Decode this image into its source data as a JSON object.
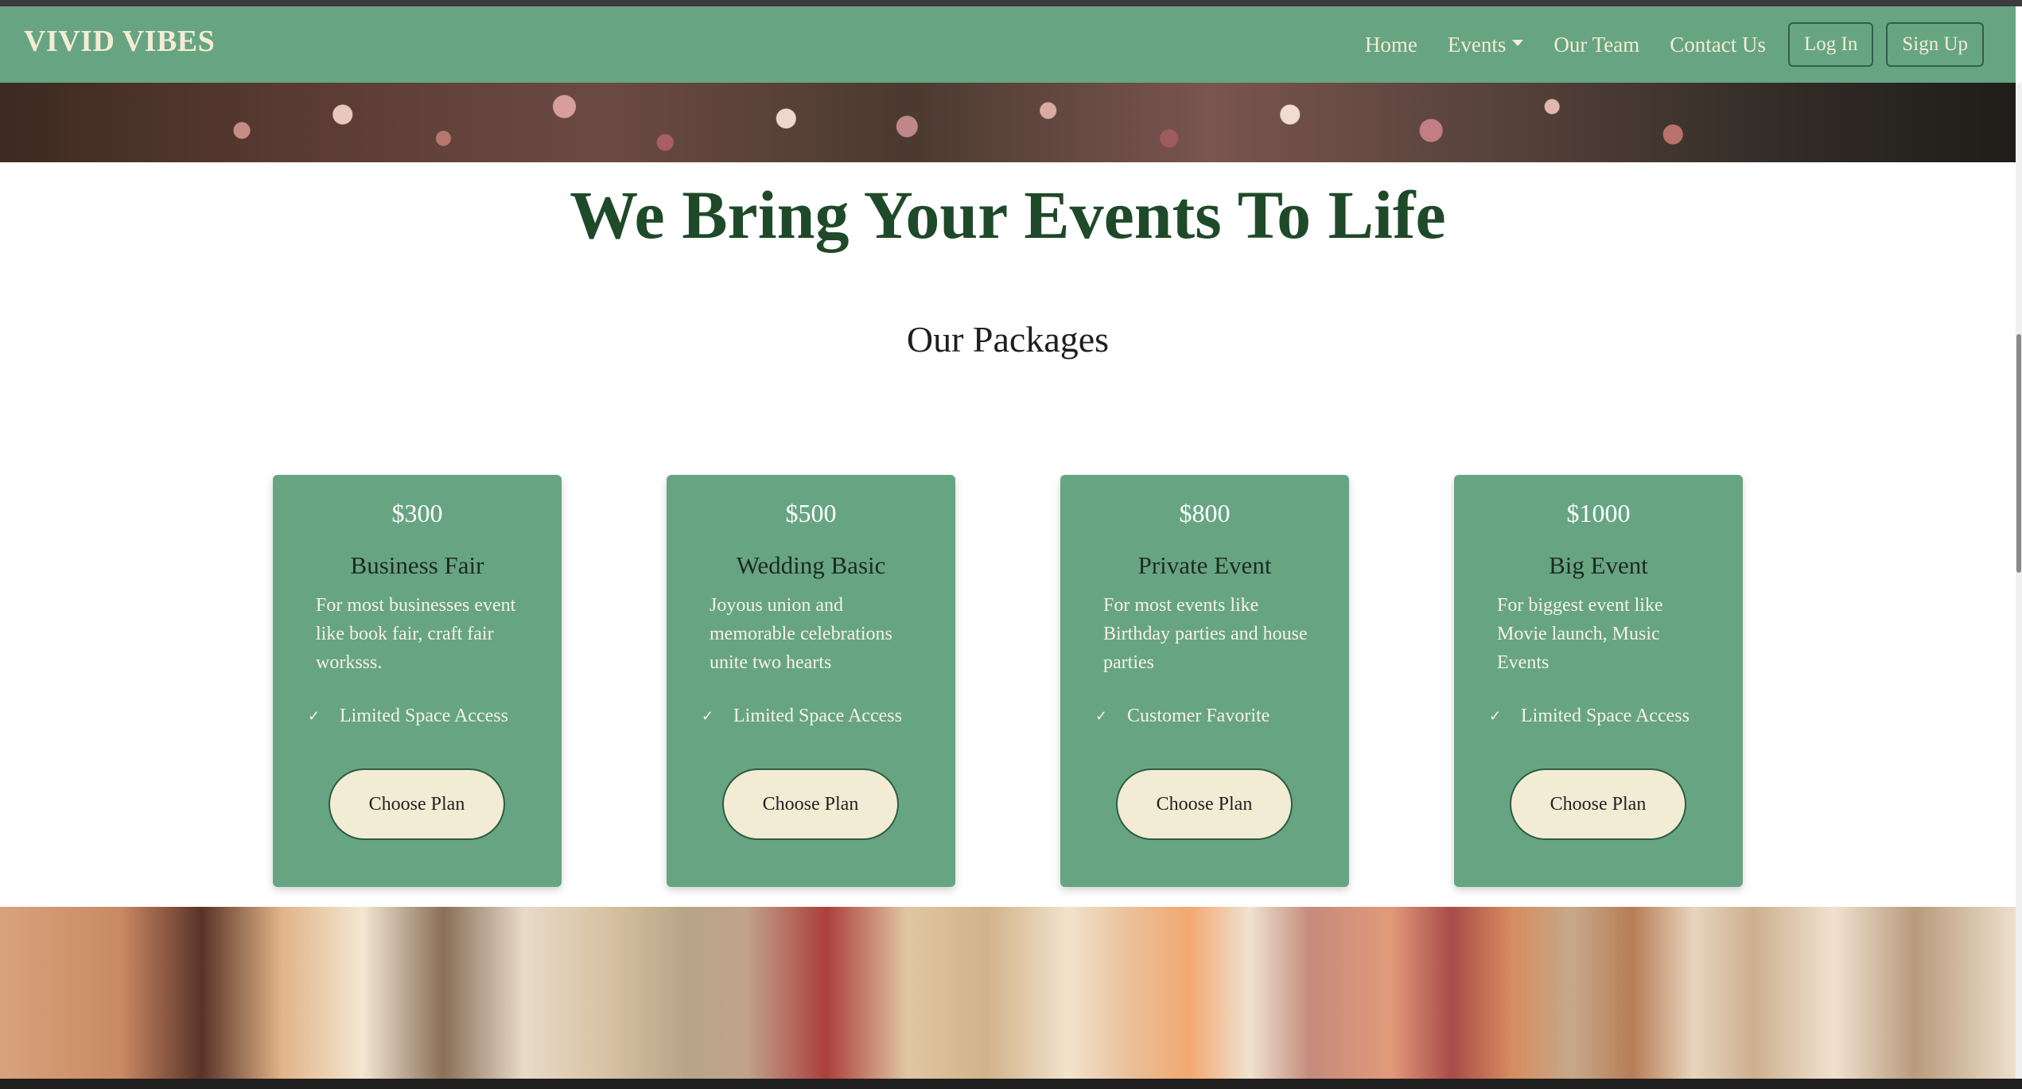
{
  "nav": {
    "brand": "VIVID VIBES",
    "links": [
      "Home",
      "Events",
      "Our Team",
      "Contact Us"
    ],
    "login": "Log In",
    "signup": "Sign Up"
  },
  "hero": {
    "title": "We Bring Your Events To Life"
  },
  "packages": {
    "heading": "Our Packages",
    "cards": [
      {
        "price": "$300",
        "title": "Business Fair",
        "description": "For most businesses event like book fair, craft fair worksss.",
        "feature": "Limited Space Access",
        "button": "Choose Plan"
      },
      {
        "price": "$500",
        "title": "Wedding Basic",
        "description": "Joyous union and memorable celebrations unite two hearts",
        "feature": "Limited Space Access",
        "button": "Choose Plan"
      },
      {
        "price": "$800",
        "title": "Private Event",
        "description": "For most events like Birthday parties and house parties",
        "feature": "Customer Favorite",
        "button": "Choose Plan"
      },
      {
        "price": "$1000",
        "title": "Big Event",
        "description": "For biggest event like Movie launch, Music Events",
        "feature": "Limited Space Access",
        "button": "Choose Plan"
      }
    ]
  },
  "icons": {
    "check": "check-icon",
    "caret": "caret-down-icon"
  },
  "colors": {
    "nav_bg": "#67a582",
    "card_bg": "#67a582",
    "title_green": "#1f4a29",
    "button_bg": "#f2ecd4",
    "nav_text": "#f3ecd3"
  }
}
